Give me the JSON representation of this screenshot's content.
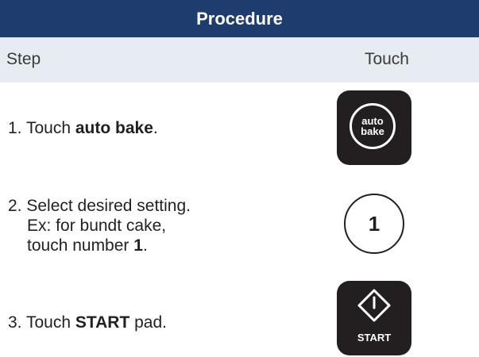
{
  "header": {
    "title": "Procedure"
  },
  "columns": {
    "step": "Step",
    "touch": "Touch"
  },
  "steps": [
    {
      "number": "1.",
      "pre": "Touch ",
      "bold": "auto bake",
      "post": "."
    },
    {
      "number": "2.",
      "line1": "Select desired setting.",
      "line2": "Ex: for bundt cake,",
      "line3_pre": "touch number ",
      "line3_bold": "1",
      "line3_post": "."
    },
    {
      "number": "3.",
      "pre": "Touch ",
      "bold": "START",
      "post": " pad."
    }
  ],
  "pads": {
    "auto_bake": {
      "line1": "auto",
      "line2": "bake",
      "icon": "auto-bake-pad"
    },
    "number": {
      "label": "1"
    },
    "start": {
      "label": "START",
      "icon": "start-diamond-icon"
    }
  },
  "colors": {
    "header_bg": "#1e3d6e",
    "subheader_bg": "#e7ecf3",
    "pad_bg": "#231f20"
  }
}
